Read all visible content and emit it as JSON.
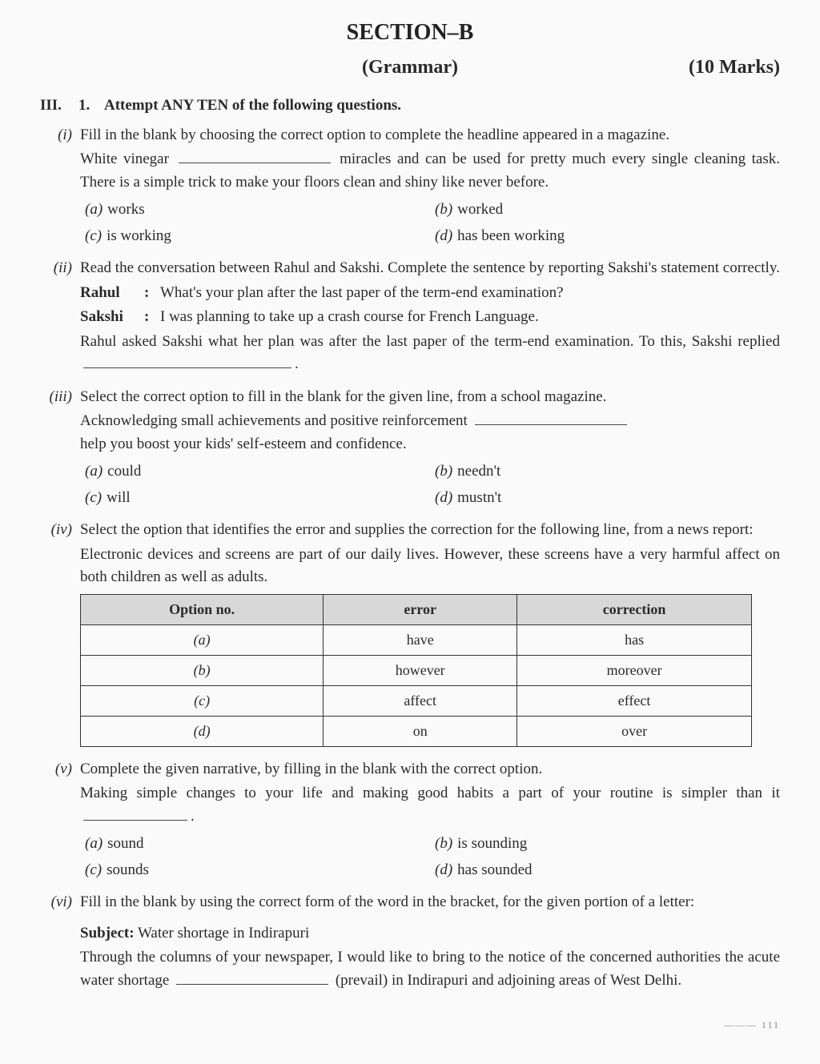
{
  "section": {
    "title": "SECTION–B",
    "subtitle": "(Grammar)",
    "marks": "(10 Marks)"
  },
  "header": {
    "roman": "III.",
    "qnum": "1.",
    "text": "Attempt ANY TEN of the following questions."
  },
  "q1": {
    "num": "(i)",
    "intro": "Fill in the blank by choosing the correct option to complete the headline appeared in a magazine.",
    "s1a": "White vinegar",
    "s1b": "miracles and can be used for pretty much every single cleaning task. There is a simple trick to make your floors clean and shiny like never before.",
    "opts": {
      "a": "(a)",
      "av": "works",
      "b": "(b)",
      "bv": "worked",
      "c": "(c)",
      "cv": "is working",
      "d": "(d)",
      "dv": "has been working"
    }
  },
  "q2": {
    "num": "(ii)",
    "intro": "Read the conversation between Rahul and Sakshi. Complete the sentence by reporting Sakshi's statement correctly.",
    "sp1": "Rahul",
    "l1": "What's your plan after the last paper of the term-end examination?",
    "sp2": "Sakshi",
    "l2": "I was planning to take up a crash course for French Language.",
    "s2": "Rahul asked Sakshi what her plan was after the last paper of the term-end examination. To this, Sakshi replied",
    "s2b": "."
  },
  "q3": {
    "num": "(iii)",
    "intro": "Select the correct option to fill in the blank for the given line, from a school magazine.",
    "s1a": "Acknowledging small achievements and positive reinforcement",
    "s1b": "help you boost your kids' self-esteem and confidence.",
    "opts": {
      "a": "(a)",
      "av": "could",
      "b": "(b)",
      "bv": "needn't",
      "c": "(c)",
      "cv": "will",
      "d": "(d)",
      "dv": "mustn't"
    }
  },
  "q4": {
    "num": "(iv)",
    "intro": "Select the option that identifies the error and supplies the correction for the following line, from a news report:",
    "s1": "Electronic devices and screens are part of our daily lives. However, these screens have a very harmful affect on both children as well as adults.",
    "table": {
      "h1": "Option no.",
      "h2": "error",
      "h3": "correction",
      "rows": [
        {
          "o": "(a)",
          "e": "have",
          "c": "has"
        },
        {
          "o": "(b)",
          "e": "however",
          "c": "moreover"
        },
        {
          "o": "(c)",
          "e": "affect",
          "c": "effect"
        },
        {
          "o": "(d)",
          "e": "on",
          "c": "over"
        }
      ]
    }
  },
  "q5": {
    "num": "(v)",
    "intro": "Complete the given narrative, by filling in the blank with the correct option.",
    "s1a": "Making simple changes to your life and making good habits a part of your routine is simpler than it",
    "s1b": ".",
    "opts": {
      "a": "(a)",
      "av": "sound",
      "b": "(b)",
      "bv": "is sounding",
      "c": "(c)",
      "cv": "sounds",
      "d": "(d)",
      "dv": "has sounded"
    }
  },
  "q6": {
    "num": "(vi)",
    "intro": "Fill in the blank by using the correct form of the word in the bracket, for the given portion of a letter:",
    "subjlbl": "Subject:",
    "subj": " Water shortage in Indirapuri",
    "s1a": "Through the columns of your newspaper, I would like to bring to the notice of the concerned authorities the acute water shortage",
    "s1b": "(prevail) in Indirapuri and adjoining areas of West Delhi."
  },
  "footer": "——— 111"
}
